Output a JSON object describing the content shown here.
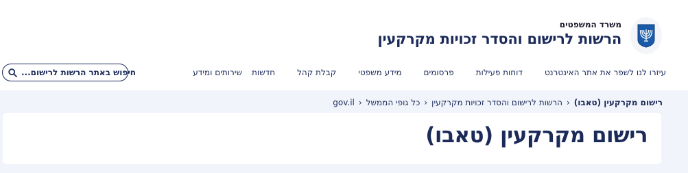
{
  "header": {
    "ministry": "משרד המשפטים",
    "authority": "הרשות לרישום והסדר זכויות מקרקעין"
  },
  "nav": {
    "items": [
      {
        "label": "שירותים ומידע"
      },
      {
        "label": "חדשות"
      },
      {
        "label": "קבלת קהל"
      },
      {
        "label": "מידע משפטי"
      },
      {
        "label": "פרסומים"
      },
      {
        "label": "דוחות פעילות"
      },
      {
        "label": "עיזרו לנו לשפר את אתר האינטרנט"
      }
    ]
  },
  "search": {
    "label": "חיפוש באתר הרשות לרישום..."
  },
  "breadcrumb": {
    "items": [
      {
        "label": "gov.il"
      },
      {
        "label": "כל גופי הממשל"
      },
      {
        "label": "הרשות לרישום והסדר זכויות מקרקעין"
      },
      {
        "label": "רישום מקרקעין (טאבו)"
      }
    ]
  },
  "page": {
    "title": "רישום מקרקעין (טאבו)"
  },
  "icons": {
    "emblem": "menorah-emblem-icon",
    "search": "search-icon",
    "breadcrumb_separator": "chevron-left-icon"
  },
  "colors": {
    "primary": "#1b2a59",
    "background": "#f1f5fb",
    "card": "#ffffff"
  }
}
